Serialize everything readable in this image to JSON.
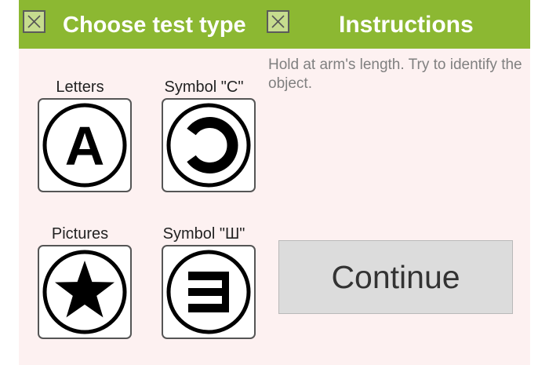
{
  "left_panel": {
    "title": "Choose test type",
    "close_icon": "close-x-icon",
    "options": [
      {
        "label": "Letters",
        "icon": "letter-a-icon"
      },
      {
        "label": "Symbol \"C\"",
        "icon": "landolt-c-icon"
      },
      {
        "label": "Pictures",
        "icon": "star-icon"
      },
      {
        "label": "Symbol \"Ш\"",
        "icon": "tumbling-sh-icon"
      }
    ]
  },
  "right_panel": {
    "title": "Instructions",
    "close_icon": "close-x-icon",
    "instruction_text": "Hold at arm's length. Try to identify the object.",
    "continue_label": "Continue"
  },
  "colors": {
    "header_bg": "#8cb832",
    "panel_bg": "#fdf1f1",
    "button_bg": "#dcdcdc",
    "instruction_text": "#808080"
  }
}
